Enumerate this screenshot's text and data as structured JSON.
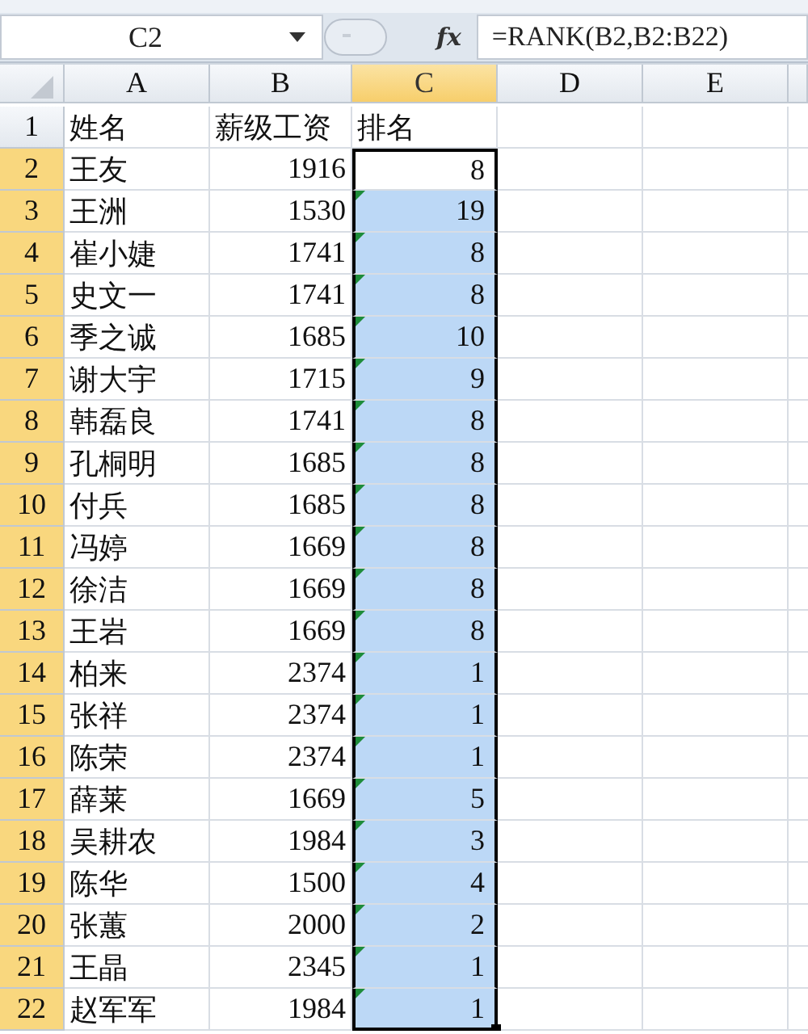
{
  "formula_bar": {
    "name_box": "C2",
    "function_button": "fx",
    "formula": "=RANK(B2,B2:B22)"
  },
  "columns": [
    {
      "label": "A",
      "selected": false
    },
    {
      "label": "B",
      "selected": false
    },
    {
      "label": "C",
      "selected": true
    },
    {
      "label": "D",
      "selected": false
    },
    {
      "label": "E",
      "selected": false
    }
  ],
  "rows": [
    {
      "header": "1",
      "selected": false,
      "name": "姓名",
      "salary": "薪级工资",
      "rank": {
        "text": "排名",
        "selected": false,
        "active": false,
        "error_flag": false
      }
    },
    {
      "header": "2",
      "selected": true,
      "name": "王友",
      "salary": "1916",
      "rank": {
        "text": "8",
        "selected": true,
        "active": true,
        "error_flag": false
      }
    },
    {
      "header": "3",
      "selected": true,
      "name": "王洲",
      "salary": "1530",
      "rank": {
        "text": "19",
        "selected": true,
        "active": false,
        "error_flag": true
      }
    },
    {
      "header": "4",
      "selected": true,
      "name": "崔小婕",
      "salary": "1741",
      "rank": {
        "text": "8",
        "selected": true,
        "active": false,
        "error_flag": true
      }
    },
    {
      "header": "5",
      "selected": true,
      "name": "史文一",
      "salary": "1741",
      "rank": {
        "text": "8",
        "selected": true,
        "active": false,
        "error_flag": true
      }
    },
    {
      "header": "6",
      "selected": true,
      "name": "季之诚",
      "salary": "1685",
      "rank": {
        "text": "10",
        "selected": true,
        "active": false,
        "error_flag": true
      }
    },
    {
      "header": "7",
      "selected": true,
      "name": "谢大宇",
      "salary": "1715",
      "rank": {
        "text": "9",
        "selected": true,
        "active": false,
        "error_flag": true
      }
    },
    {
      "header": "8",
      "selected": true,
      "name": "韩磊良",
      "salary": "1741",
      "rank": {
        "text": "8",
        "selected": true,
        "active": false,
        "error_flag": true
      }
    },
    {
      "header": "9",
      "selected": true,
      "name": "孔桐明",
      "salary": "1685",
      "rank": {
        "text": "8",
        "selected": true,
        "active": false,
        "error_flag": true
      }
    },
    {
      "header": "10",
      "selected": true,
      "name": "付兵",
      "salary": "1685",
      "rank": {
        "text": "8",
        "selected": true,
        "active": false,
        "error_flag": true
      }
    },
    {
      "header": "11",
      "selected": true,
      "name": "冯婷",
      "salary": "1669",
      "rank": {
        "text": "8",
        "selected": true,
        "active": false,
        "error_flag": true
      }
    },
    {
      "header": "12",
      "selected": true,
      "name": "徐洁",
      "salary": "1669",
      "rank": {
        "text": "8",
        "selected": true,
        "active": false,
        "error_flag": true
      }
    },
    {
      "header": "13",
      "selected": true,
      "name": "王岩",
      "salary": "1669",
      "rank": {
        "text": "8",
        "selected": true,
        "active": false,
        "error_flag": true
      }
    },
    {
      "header": "14",
      "selected": true,
      "name": "柏来",
      "salary": "2374",
      "rank": {
        "text": "1",
        "selected": true,
        "active": false,
        "error_flag": true
      }
    },
    {
      "header": "15",
      "selected": true,
      "name": "张祥",
      "salary": "2374",
      "rank": {
        "text": "1",
        "selected": true,
        "active": false,
        "error_flag": true
      }
    },
    {
      "header": "16",
      "selected": true,
      "name": "陈荣",
      "salary": "2374",
      "rank": {
        "text": "1",
        "selected": true,
        "active": false,
        "error_flag": true
      }
    },
    {
      "header": "17",
      "selected": true,
      "name": "薛莱",
      "salary": "1669",
      "rank": {
        "text": "5",
        "selected": true,
        "active": false,
        "error_flag": true
      }
    },
    {
      "header": "18",
      "selected": true,
      "name": "吴耕农",
      "salary": "1984",
      "rank": {
        "text": "3",
        "selected": true,
        "active": false,
        "error_flag": true
      }
    },
    {
      "header": "19",
      "selected": true,
      "name": "陈华",
      "salary": "1500",
      "rank": {
        "text": "4",
        "selected": true,
        "active": false,
        "error_flag": true
      }
    },
    {
      "header": "20",
      "selected": true,
      "name": "张蕙",
      "salary": "2000",
      "rank": {
        "text": "2",
        "selected": true,
        "active": false,
        "error_flag": true
      }
    },
    {
      "header": "21",
      "selected": true,
      "name": "王晶",
      "salary": "2345",
      "rank": {
        "text": "1",
        "selected": true,
        "active": false,
        "error_flag": true
      }
    },
    {
      "header": "22",
      "selected": true,
      "name": "赵军军",
      "salary": "1984",
      "rank": {
        "text": "1",
        "selected": true,
        "active": false,
        "error_flag": true
      }
    }
  ]
}
